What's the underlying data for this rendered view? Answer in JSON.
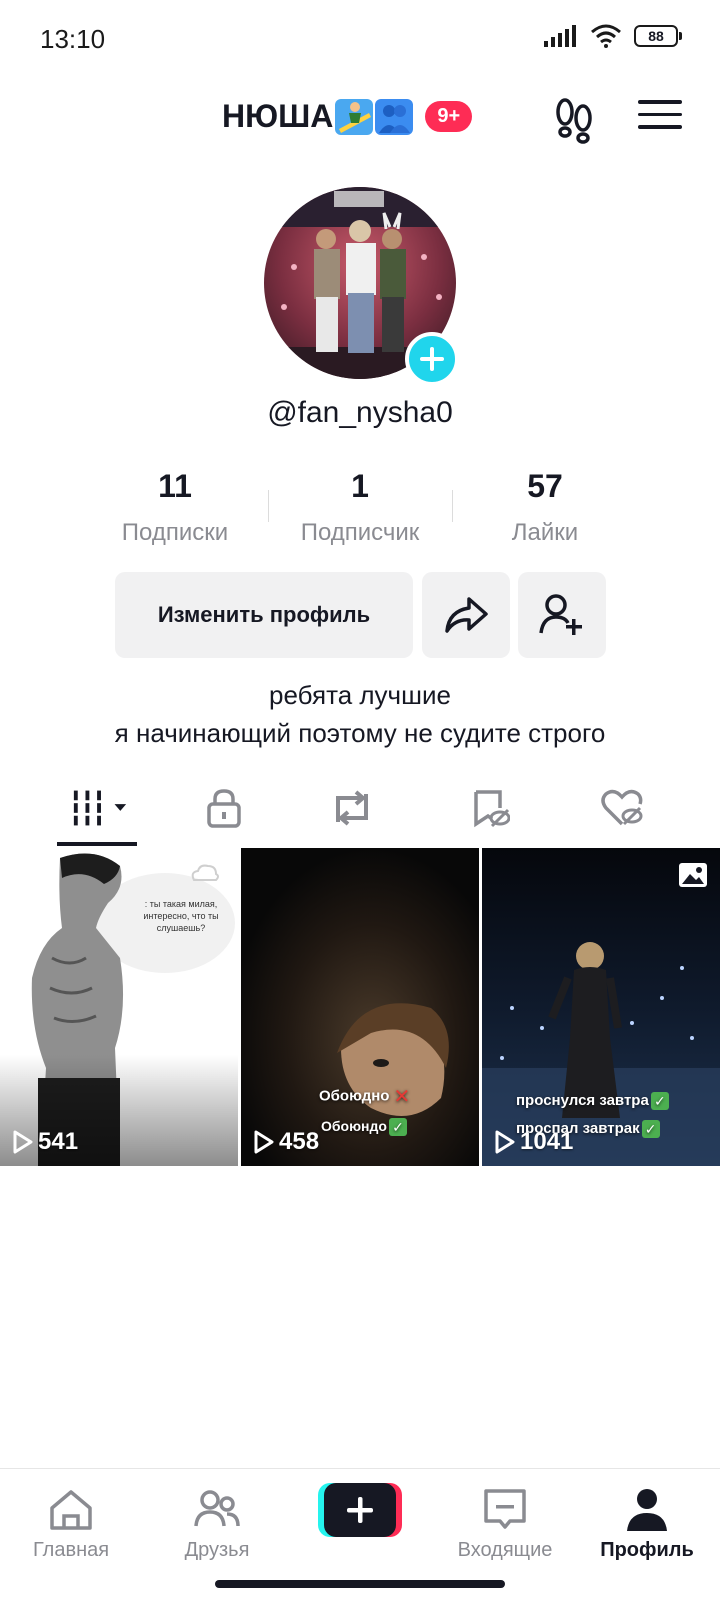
{
  "status_bar": {
    "time": "13:10",
    "battery": "88"
  },
  "header": {
    "name": "НЮША",
    "name_emojis": [
      "surfer-emoji",
      "people-emoji"
    ],
    "badge": "9+"
  },
  "profile": {
    "username": "@fan_nysha0",
    "stats": [
      {
        "value": "11",
        "label": "Подписки"
      },
      {
        "value": "1",
        "label": "Подписчик"
      },
      {
        "value": "57",
        "label": "Лайки"
      }
    ],
    "edit_label": "Изменить профиль",
    "bio_line1": "ребята лучшие",
    "bio_line2": "я начинающий поэтому не судите строго"
  },
  "tabs": [
    "videos-grid-icon",
    "lock-icon",
    "repost-icon",
    "bookmark-icon",
    "liked-icon"
  ],
  "videos": [
    {
      "views": "541",
      "caption": ": ты такая милая, интересно, что ты слушаешь?"
    },
    {
      "views": "458",
      "line1": "Обоюдно",
      "line2": "Обоюндо"
    },
    {
      "views": "1041",
      "line1": "проснулся завтра",
      "line2": "проспал завтрак"
    }
  ],
  "nav": {
    "home": "Главная",
    "friends": "Друзья",
    "inbox": "Входящие",
    "profile": "Профиль"
  },
  "colors": {
    "accent": "#fe2c55",
    "cyan": "#25f4ee",
    "plus": "#20d5ec"
  }
}
